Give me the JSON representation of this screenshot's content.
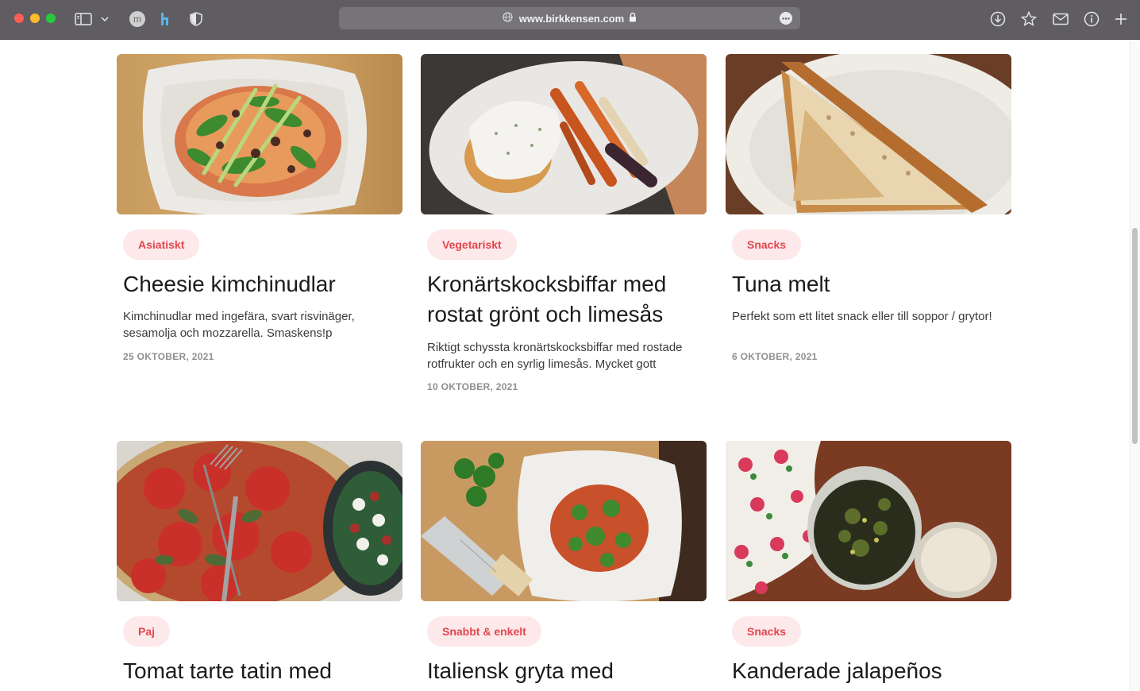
{
  "browser": {
    "url": "www.birkkensen.com",
    "profile_initial": "m"
  },
  "cards": [
    {
      "category": "Asiatiskt",
      "title": "Cheesie kimchinudlar",
      "description": "Kimchinudlar med ingefära, svart risvinäger, sesamolja och mozzarella. Smaskens!p",
      "date": "25 OKTOBER, 2021"
    },
    {
      "category": "Vegetariskt",
      "title": "Kronärtskocksbiffar med rostat grönt och limesås",
      "description": "Riktigt schyssta kronärtskocksbiffar med rostade rotfrukter och en syrlig limesås. Mycket gott",
      "date": "10 OKTOBER, 2021"
    },
    {
      "category": "Snacks",
      "title": "Tuna melt",
      "description": "Perfekt som ett litet snack eller till soppor / grytor!",
      "date": "6 OKTOBER, 2021"
    },
    {
      "category": "Paj",
      "title": "Tomat tarte tatin med",
      "description": "",
      "date": ""
    },
    {
      "category": "Snabbt & enkelt",
      "title": "Italiensk gryta med",
      "description": "",
      "date": ""
    },
    {
      "category": "Snacks",
      "title": "Kanderade jalapeños",
      "description": "",
      "date": ""
    }
  ]
}
